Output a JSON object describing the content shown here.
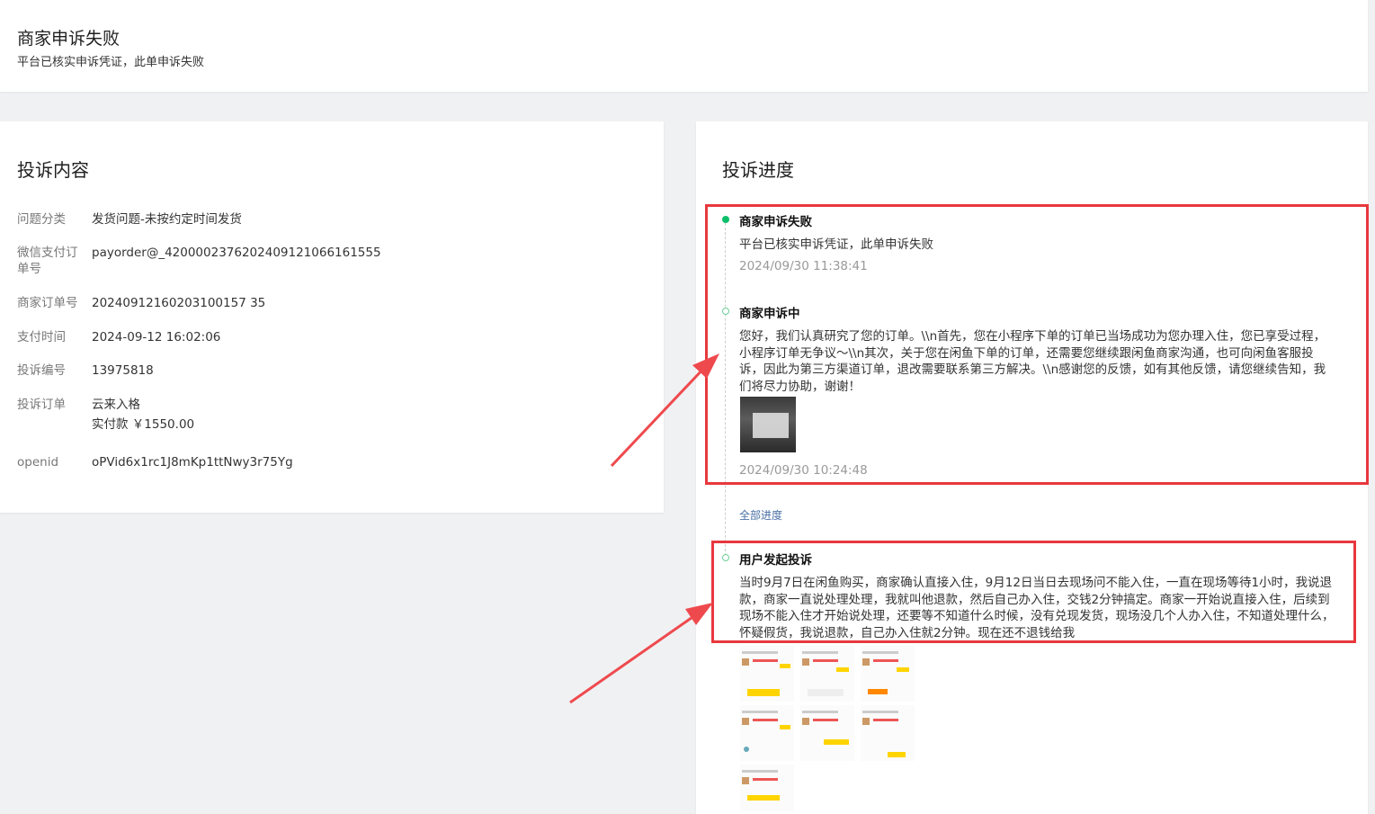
{
  "header": {
    "title": "商家申诉失败",
    "subtitle": "平台已核实申诉凭证，此单申诉失败"
  },
  "complaint": {
    "section_title": "投诉内容",
    "rows": [
      {
        "label": "问题分类",
        "value": "发货问题-未按约定时间发货"
      },
      {
        "label": "微信支付订单号",
        "value": "payorder@_4200002376202409121066161555"
      },
      {
        "label": "商家订单号",
        "value": "20240912160203100157 35"
      },
      {
        "label": "支付时间",
        "value": "2024-09-12 16:02:06"
      },
      {
        "label": "投诉编号",
        "value": "13975818"
      },
      {
        "label": "投诉订单",
        "value": "云来入格",
        "sub": "实付款 ￥1550.00"
      },
      {
        "label": "openid",
        "value": "oPVid6x1rc1J8mKp1ttNwy3r75Yg"
      }
    ]
  },
  "progress": {
    "section_title": "投诉进度",
    "nodes": [
      {
        "title": "商家申诉失败",
        "text": "平台已核实申诉凭证，此单申诉失败",
        "time": "2024/09/30 11:38:41"
      },
      {
        "title": "商家申诉中",
        "text": "您好，我们认真研究了您的订单。\\\\n首先，您在小程序下单的订单已当场成功为您办理入住，您已享受过程，小程序订单无争议～\\\\n其次，关于您在闲鱼下单的订单，还需要您继续跟闲鱼商家沟通，也可向闲鱼客服投诉，因此为第三方渠道订单，退改需要联系第三方解决。\\\\n感谢您的反馈，如有其他反馈，请您继续告知，我们将尽力协助，谢谢！",
        "time": "2024/09/30 10:24:48"
      },
      {
        "title": "用户发起投诉",
        "text": "当时9月7日在闲鱼购买，商家确认直接入住，9月12日当日去现场问不能入住，一直在现场等待1小时，我说退款，商家一直说处理处理，我就叫他退款，然后自己办入住，交钱2分钟搞定。商家一开始说直接入住，后续到现场不能入住才开始说处理，还要等不知道什么时候，没有兑现发货，现场没几个人办入住，不知道处理什么，怀疑假货，我说退款，自己办入住就2分钟。现在还不退钱给我"
      }
    ],
    "more_link": "全部进度"
  },
  "colors": {
    "accent_green": "#0bbf6a",
    "annotation_red": "#e8383d",
    "link_blue": "#4a6fa5"
  }
}
